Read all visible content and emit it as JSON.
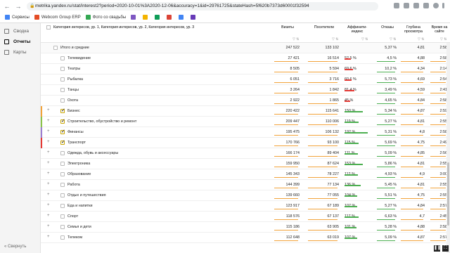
{
  "browser": {
    "url": "metrika.yandex.ru/stat/interest2?period=2020-10-01%3A2020-12-06&accuracy=1&id=29761725&stateHash=5f620b7373d60001f32594",
    "back_icon": "arrow-left-icon",
    "forward_icon": "arrow-right-icon",
    "reload_icon": "reload-icon"
  },
  "bookmarks": [
    {
      "label": "Сервисы",
      "color": "#4285f4"
    },
    {
      "label": "Webcom Group ERP",
      "color": "#e44d26"
    },
    {
      "label": "Фото со свадьбы",
      "color": "#34a853"
    },
    {
      "label": "",
      "color": "#7e57c2"
    },
    {
      "label": "",
      "color": "#f4b400"
    },
    {
      "label": "",
      "color": "#0f9d58"
    },
    {
      "label": "",
      "color": "#db4437"
    },
    {
      "label": "",
      "color": "#4285f4"
    },
    {
      "label": "",
      "color": "#673ab7"
    }
  ],
  "sidebar": {
    "items": [
      {
        "label": "Сводка",
        "active": false
      },
      {
        "label": "Отчеты",
        "active": true
      },
      {
        "label": "Карты",
        "active": false
      }
    ],
    "collapse_label": "Свернуть"
  },
  "table": {
    "header_title": "Категория интересов, ур. 1, Категория интересов, ур. 2, Категория интересов, ур. 3",
    "columns": [
      {
        "label": "Визиты"
      },
      {
        "label": "Посетители"
      },
      {
        "label": "Аффинити-индекс"
      },
      {
        "label": "Отказы"
      },
      {
        "label": "Глубина просмотра"
      },
      {
        "label": "Время на сайте"
      }
    ],
    "rows": [
      {
        "label": "Итого и средние",
        "level": 0,
        "expand": "",
        "checked": false,
        "visits": "247 522",
        "visitors": "133 102",
        "affinity": "",
        "bounce": "5,37 %",
        "depth": "4,81",
        "time": "2:58",
        "bar": "",
        "affbar": 0
      },
      {
        "label": "Телевидение",
        "level": 2,
        "expand": "",
        "checked": false,
        "visits": "27 421",
        "visitors": "16 514",
        "affinity": "52,5 %",
        "bounce": "4,5 %",
        "depth": "4,88",
        "time": "2:58",
        "bar": "",
        "affbar": 0.53
      },
      {
        "label": "Театры",
        "level": 2,
        "expand": "",
        "checked": false,
        "visits": "8 505",
        "visitors": "5 594",
        "affinity": "69,6 %",
        "bounce": "10,2 %",
        "depth": "4,34",
        "time": "2:14",
        "bar": "",
        "affbar": 0.7
      },
      {
        "label": "Рыбалка",
        "level": 2,
        "expand": "",
        "checked": false,
        "visits": "6 051",
        "visitors": "3 716",
        "affinity": "60,6 %",
        "bounce": "5,73 %",
        "depth": "4,69",
        "time": "2:54",
        "bar": "",
        "affbar": 0.61
      },
      {
        "label": "Танцы",
        "level": 2,
        "expand": "",
        "checked": false,
        "visits": "3 264",
        "visitors": "1 842",
        "affinity": "81,4 %",
        "bounce": "3,49 %",
        "depth": "4,59",
        "time": "2:41",
        "bar": "",
        "affbar": 0.81
      },
      {
        "label": "Охота",
        "level": 2,
        "expand": "",
        "checked": false,
        "visits": "2 922",
        "visitors": "1 865",
        "affinity": "45 %",
        "bounce": "4,65 %",
        "depth": "4,84",
        "time": "2:58",
        "bar": "",
        "affbar": 0.45
      },
      {
        "label": "Бизнес",
        "level": 1,
        "expand": "+",
        "checked": true,
        "visits": "220 422",
        "visitors": "115 641",
        "affinity": "150 %",
        "bounce": "5,34 %",
        "depth": "4,87",
        "time": "2:59",
        "bar": "#f2a33a",
        "affbar": 1.5
      },
      {
        "label": "Строительство, обустройство и ремонт",
        "level": 1,
        "expand": "+",
        "checked": true,
        "visits": "209 447",
        "visitors": "110 006",
        "affinity": "119 %",
        "bounce": "5,27 %",
        "depth": "4,81",
        "time": "2:55",
        "bar": "#8bc34a",
        "affbar": 1.19
      },
      {
        "label": "Финансы",
        "level": 1,
        "expand": "+",
        "checked": true,
        "visits": "195 475",
        "visitors": "106 132",
        "affinity": "192 %",
        "bounce": "5,31 %",
        "depth": "4,8",
        "time": "2:58",
        "bar": "#9c7fd1",
        "affbar": 1.92
      },
      {
        "label": "Транспорт",
        "level": 1,
        "expand": "+",
        "checked": true,
        "visits": "170 766",
        "visitors": "93 100",
        "affinity": "115 %",
        "bounce": "5,69 %",
        "depth": "4,75",
        "time": "2:49",
        "bar": "#e53935",
        "affbar": 1.15
      },
      {
        "label": "Одежда, обувь и аксессуары",
        "level": 1,
        "expand": "+",
        "checked": false,
        "visits": "166 174",
        "visitors": "89 404",
        "affinity": "111 %",
        "bounce": "5,09 %",
        "depth": "4,85",
        "time": "2:56",
        "bar": "",
        "affbar": 1.11
      },
      {
        "label": "Электроника",
        "level": 1,
        "expand": "+",
        "checked": false,
        "visits": "159 950",
        "visitors": "87 624",
        "affinity": "153 %",
        "bounce": "5,86 %",
        "depth": "4,81",
        "time": "2:55",
        "bar": "",
        "affbar": 1.53
      },
      {
        "label": "Образование",
        "level": 1,
        "expand": "+",
        "checked": false,
        "visits": "145 343",
        "visitors": "78 227",
        "affinity": "112 %",
        "bounce": "4,93 %",
        "depth": "4,9",
        "time": "3:00",
        "bar": "",
        "affbar": 1.12
      },
      {
        "label": "Работа",
        "level": 1,
        "expand": "+",
        "checked": false,
        "visits": "144 399",
        "visitors": "77 134",
        "affinity": "136 %",
        "bounce": "5,45 %",
        "depth": "4,81",
        "time": "2:55",
        "bar": "",
        "affbar": 1.36
      },
      {
        "label": "Отдых и путешествия",
        "level": 1,
        "expand": "+",
        "checked": false,
        "visits": "139 660",
        "visitors": "77 055",
        "affinity": "104 %",
        "bounce": "5,51 %",
        "depth": "4,75",
        "time": "2:55",
        "bar": "",
        "affbar": 1.04
      },
      {
        "label": "Еда и напитки",
        "level": 1,
        "expand": "+",
        "checked": false,
        "visits": "123 917",
        "visitors": "67 189",
        "affinity": "107 %",
        "bounce": "5,27 %",
        "depth": "4,84",
        "time": "2:57",
        "bar": "",
        "affbar": 1.07
      },
      {
        "label": "Спорт",
        "level": 1,
        "expand": "+",
        "checked": false,
        "visits": "118 576",
        "visitors": "67 137",
        "affinity": "117 %",
        "bounce": "6,63 %",
        "depth": "4,7",
        "time": "2:45",
        "bar": "",
        "affbar": 1.17
      },
      {
        "label": "Семья и дети",
        "level": 1,
        "expand": "+",
        "checked": false,
        "visits": "115 186",
        "visitors": "63 905",
        "affinity": "101 %",
        "bounce": "5,28 %",
        "depth": "4,88",
        "time": "2:58",
        "bar": "",
        "affbar": 1.01
      },
      {
        "label": "Телеком",
        "level": 1,
        "expand": "+",
        "checked": false,
        "visits": "112 648",
        "visitors": "63 019",
        "affinity": "107 %",
        "bounce": "5,09 %",
        "depth": "4,87",
        "time": "2:57",
        "bar": "",
        "affbar": 1.07
      }
    ]
  },
  "video": {
    "pause_icon": "pause-icon",
    "fullscreen_icon": "fullscreen-icon"
  }
}
